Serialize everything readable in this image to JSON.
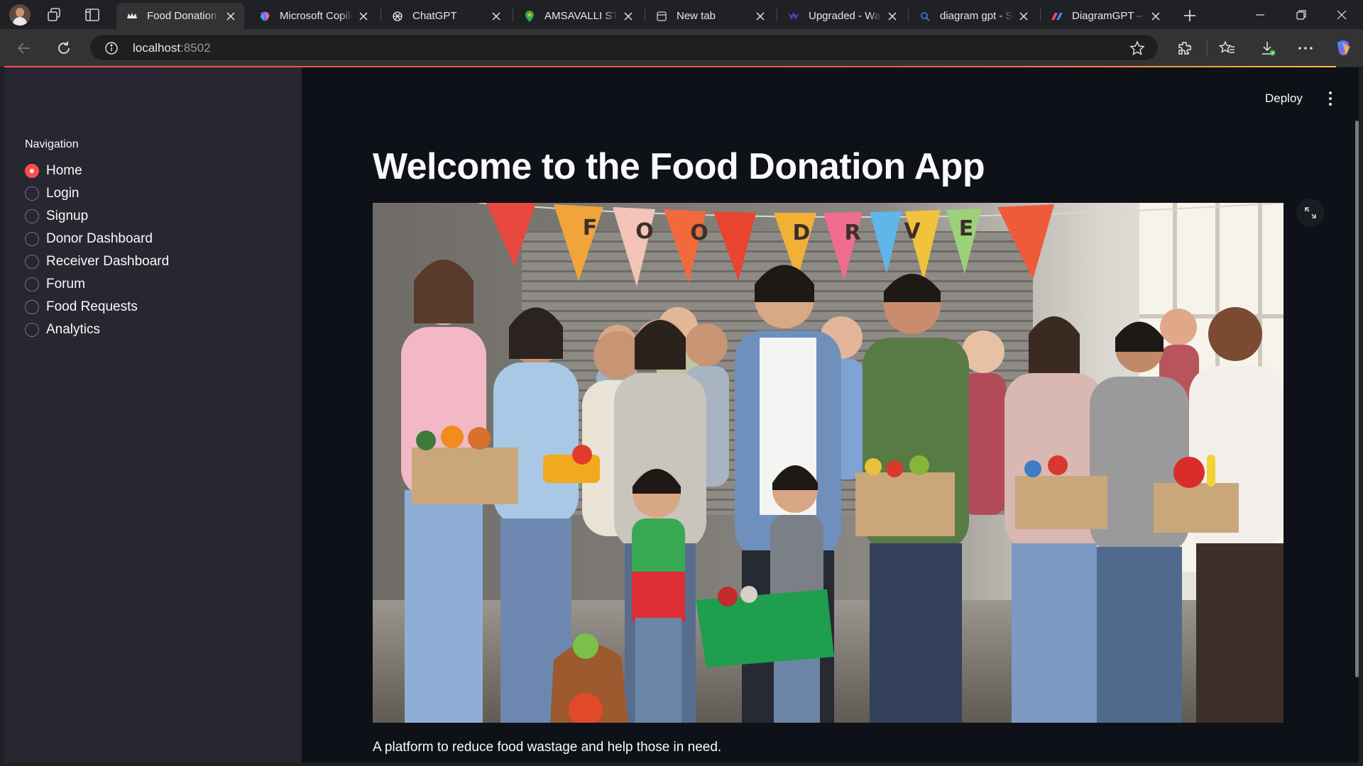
{
  "browser": {
    "tabs": [
      {
        "title": "Food Donation App",
        "active": true
      },
      {
        "title": "Microsoft Copilot"
      },
      {
        "title": "ChatGPT"
      },
      {
        "title": "AMSAVALLI STORE"
      },
      {
        "title": "New tab"
      },
      {
        "title": "Upgraded - Wapp"
      },
      {
        "title": "diagram gpt - Search"
      },
      {
        "title": "DiagramGPT – AI"
      }
    ],
    "url_host": "localhost",
    "url_port": ":8502"
  },
  "app": {
    "deploy_label": "Deploy",
    "sidebar": {
      "heading": "Navigation",
      "items": [
        {
          "label": "Home",
          "selected": true
        },
        {
          "label": "Login",
          "selected": false
        },
        {
          "label": "Signup",
          "selected": false
        },
        {
          "label": "Donor Dashboard",
          "selected": false
        },
        {
          "label": "Receiver Dashboard",
          "selected": false
        },
        {
          "label": "Forum",
          "selected": false
        },
        {
          "label": "Food Requests",
          "selected": false
        },
        {
          "label": "Analytics",
          "selected": false
        }
      ]
    },
    "title": "Welcome to the Food Donation App",
    "image_banner_letters": [
      "F",
      "O",
      "O",
      "D",
      "R",
      "V",
      "E"
    ],
    "caption": "A platform to reduce food wastage and help those in need."
  },
  "colors": {
    "accent": "#ff4b4b",
    "sidebar_bg": "#262730",
    "main_bg": "#0e1117",
    "chrome_bg": "#202124"
  }
}
